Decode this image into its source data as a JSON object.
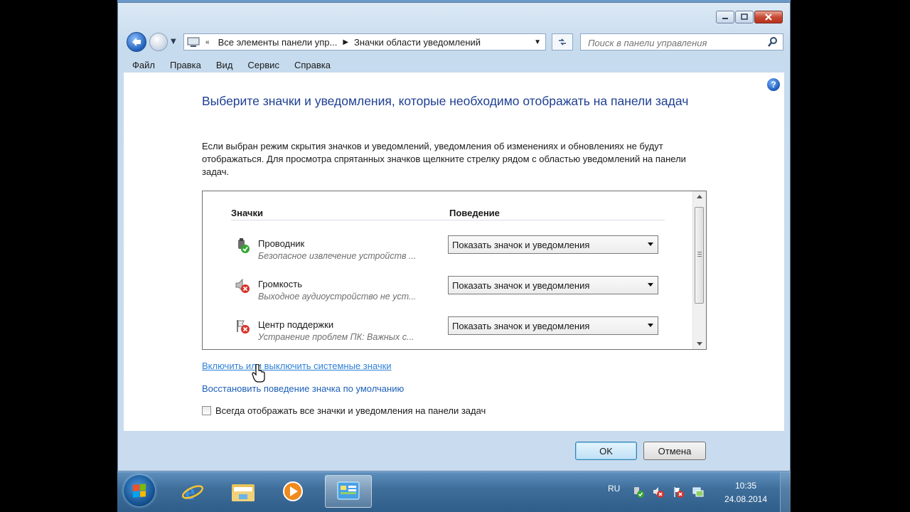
{
  "window": {
    "address": {
      "crumb1": "Все элементы панели упр...",
      "crumb2": "Значки области уведомлений"
    },
    "search_placeholder": "Поиск в панели управления",
    "menu": [
      "Файл",
      "Правка",
      "Вид",
      "Сервис",
      "Справка"
    ]
  },
  "content": {
    "heading": "Выберите значки и уведомления, которые необходимо отображать на панели задач",
    "description": "Если выбран режим скрытия значков и уведомлений, уведомления об изменениях и обновлениях не будут отображаться. Для просмотра спрятанных значков щелкните стрелку рядом с областью уведомлений на панели задач.",
    "table": {
      "col_icons": "Значки",
      "col_behavior": "Поведение",
      "rows": [
        {
          "name": "Проводник",
          "desc": "Безопасное извлечение устройств ...",
          "behavior": "Показать значок и уведомления",
          "icon": "explorer-safe-remove-icon"
        },
        {
          "name": "Громкость",
          "desc": "Выходное аудиоустройство не уст...",
          "behavior": "Показать значок и уведомления",
          "icon": "volume-muted-icon"
        },
        {
          "name": "Центр поддержки",
          "desc": "Устранение проблем ПК: Важных с...",
          "behavior": "Показать значок и уведомления",
          "icon": "action-center-flag-icon"
        }
      ]
    },
    "link_system_icons": "Включить или выключить системные значки",
    "link_restore": "Восстановить поведение значка по умолчанию",
    "checkbox_label": "Всегда отображать все значки и уведомления на панели задач",
    "checkbox_checked": false
  },
  "buttons": {
    "ok": "OK",
    "cancel": "Отмена"
  },
  "taskbar": {
    "apps": [
      "internet-explorer-icon",
      "windows-explorer-icon",
      "media-player-icon",
      "control-panel-icon"
    ],
    "active_app": "control-panel-icon",
    "language": "RU",
    "time": "10:35",
    "date": "24.08.2014"
  }
}
